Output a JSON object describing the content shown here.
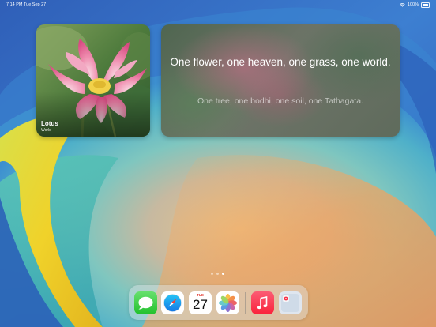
{
  "status_bar": {
    "time": "7:14 PM",
    "date": "Tue Sep 27",
    "battery": "100%",
    "wifi_icon": "wifi-icon",
    "battery_icon": "battery-icon"
  },
  "photo_widget": {
    "title": "Lotus",
    "subtitle": "World"
  },
  "quote_widget": {
    "line1": "One flower, one heaven, one grass, one world.",
    "line2": "One tree, one bodhi, one soil, one Tathagata."
  },
  "page_indicator": {
    "pages": 3,
    "current": 3
  },
  "dock": {
    "apps": [
      {
        "name": "Messages",
        "icon": "messages-icon"
      },
      {
        "name": "Safari",
        "icon": "safari-icon"
      },
      {
        "name": "Calendar",
        "icon": "calendar-icon",
        "day": "TUE",
        "date": "27"
      },
      {
        "name": "Photos",
        "icon": "photos-icon"
      },
      {
        "name": "Music",
        "icon": "music-icon"
      },
      {
        "name": "Recent app folder",
        "icon": "folder-icon"
      }
    ]
  },
  "colors": {
    "wallpaper_blue": "#3b78c9",
    "wallpaper_yellow": "#f0d22a",
    "wallpaper_teal": "#4fc4c6",
    "wallpaper_peach": "#f2a35e",
    "accent_red": "#e0332b"
  }
}
